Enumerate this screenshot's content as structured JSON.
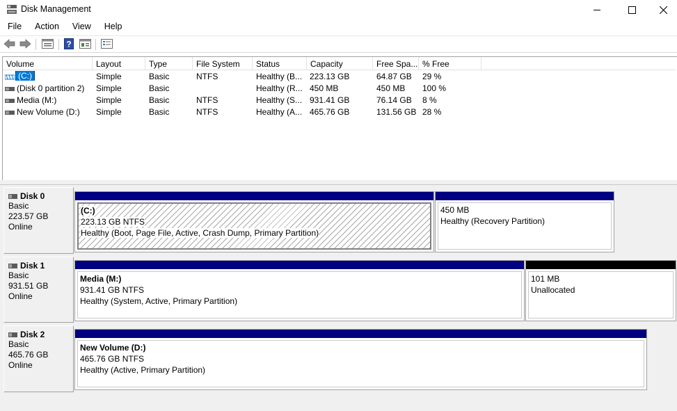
{
  "window": {
    "title": "Disk Management",
    "app_icon": "disk-management-icon",
    "controls": [
      "minimize-icon",
      "maximize-icon",
      "close-icon"
    ]
  },
  "menu": {
    "items": [
      {
        "label": "File"
      },
      {
        "label": "Action"
      },
      {
        "label": "View"
      },
      {
        "label": "Help"
      }
    ]
  },
  "toolbar": {
    "buttons": [
      "back-arrow-icon",
      "forward-arrow-icon",
      "properties-icon",
      "help-icon",
      "refresh-view-icon",
      "disk-list-icon"
    ]
  },
  "volume_list": {
    "columns": [
      "Volume",
      "Layout",
      "Type",
      "File System",
      "Status",
      "Capacity",
      "Free Spa...",
      "% Free"
    ],
    "rows": [
      {
        "volume": "(C:)",
        "layout": "Simple",
        "type": "Basic",
        "fs": "NTFS",
        "status": "Healthy (B...",
        "capacity": "223.13 GB",
        "free": "64.87 GB",
        "pct": "29 %",
        "selected": true
      },
      {
        "volume": "(Disk 0 partition 2)",
        "layout": "Simple",
        "type": "Basic",
        "fs": "",
        "status": "Healthy (R...",
        "capacity": "450 MB",
        "free": "450 MB",
        "pct": "100 %",
        "selected": false
      },
      {
        "volume": "Media (M:)",
        "layout": "Simple",
        "type": "Basic",
        "fs": "NTFS",
        "status": "Healthy (S...",
        "capacity": "931.41 GB",
        "free": "76.14 GB",
        "pct": "8 %",
        "selected": false
      },
      {
        "volume": "New Volume (D:)",
        "layout": "Simple",
        "type": "Basic",
        "fs": "NTFS",
        "status": "Healthy (A...",
        "capacity": "465.76 GB",
        "free": "131.56 GB",
        "pct": "28 %",
        "selected": false
      }
    ]
  },
  "disks": [
    {
      "name": "Disk 0",
      "type": "Basic",
      "size": "223.57 GB",
      "state": "Online",
      "partitions": [
        {
          "name": "(C:)",
          "size": "223.13 GB NTFS",
          "status": "Healthy (Boot, Page File, Active, Crash Dump, Primary Partition)",
          "selected": true
        },
        {
          "name": "",
          "size": "450 MB",
          "status": "Healthy (Recovery Partition)"
        }
      ]
    },
    {
      "name": "Disk 1",
      "type": "Basic",
      "size": "931.51 GB",
      "state": "Online",
      "partitions": [
        {
          "name": "Media  (M:)",
          "size": "931.41 GB NTFS",
          "status": "Healthy (System, Active, Primary Partition)"
        },
        {
          "name": "",
          "size": "101 MB",
          "status": "Unallocated"
        }
      ]
    },
    {
      "name": "Disk 2",
      "type": "Basic",
      "size": "465.76 GB",
      "state": "Online",
      "partitions": [
        {
          "name": "New Volume  (D:)",
          "size": "465.76 GB NTFS",
          "status": "Healthy (Active, Primary Partition)"
        }
      ]
    }
  ],
  "colors": {
    "primary_partition_bar": "#000080",
    "unallocated_bar": "#000000",
    "selection": "#0078d7"
  }
}
